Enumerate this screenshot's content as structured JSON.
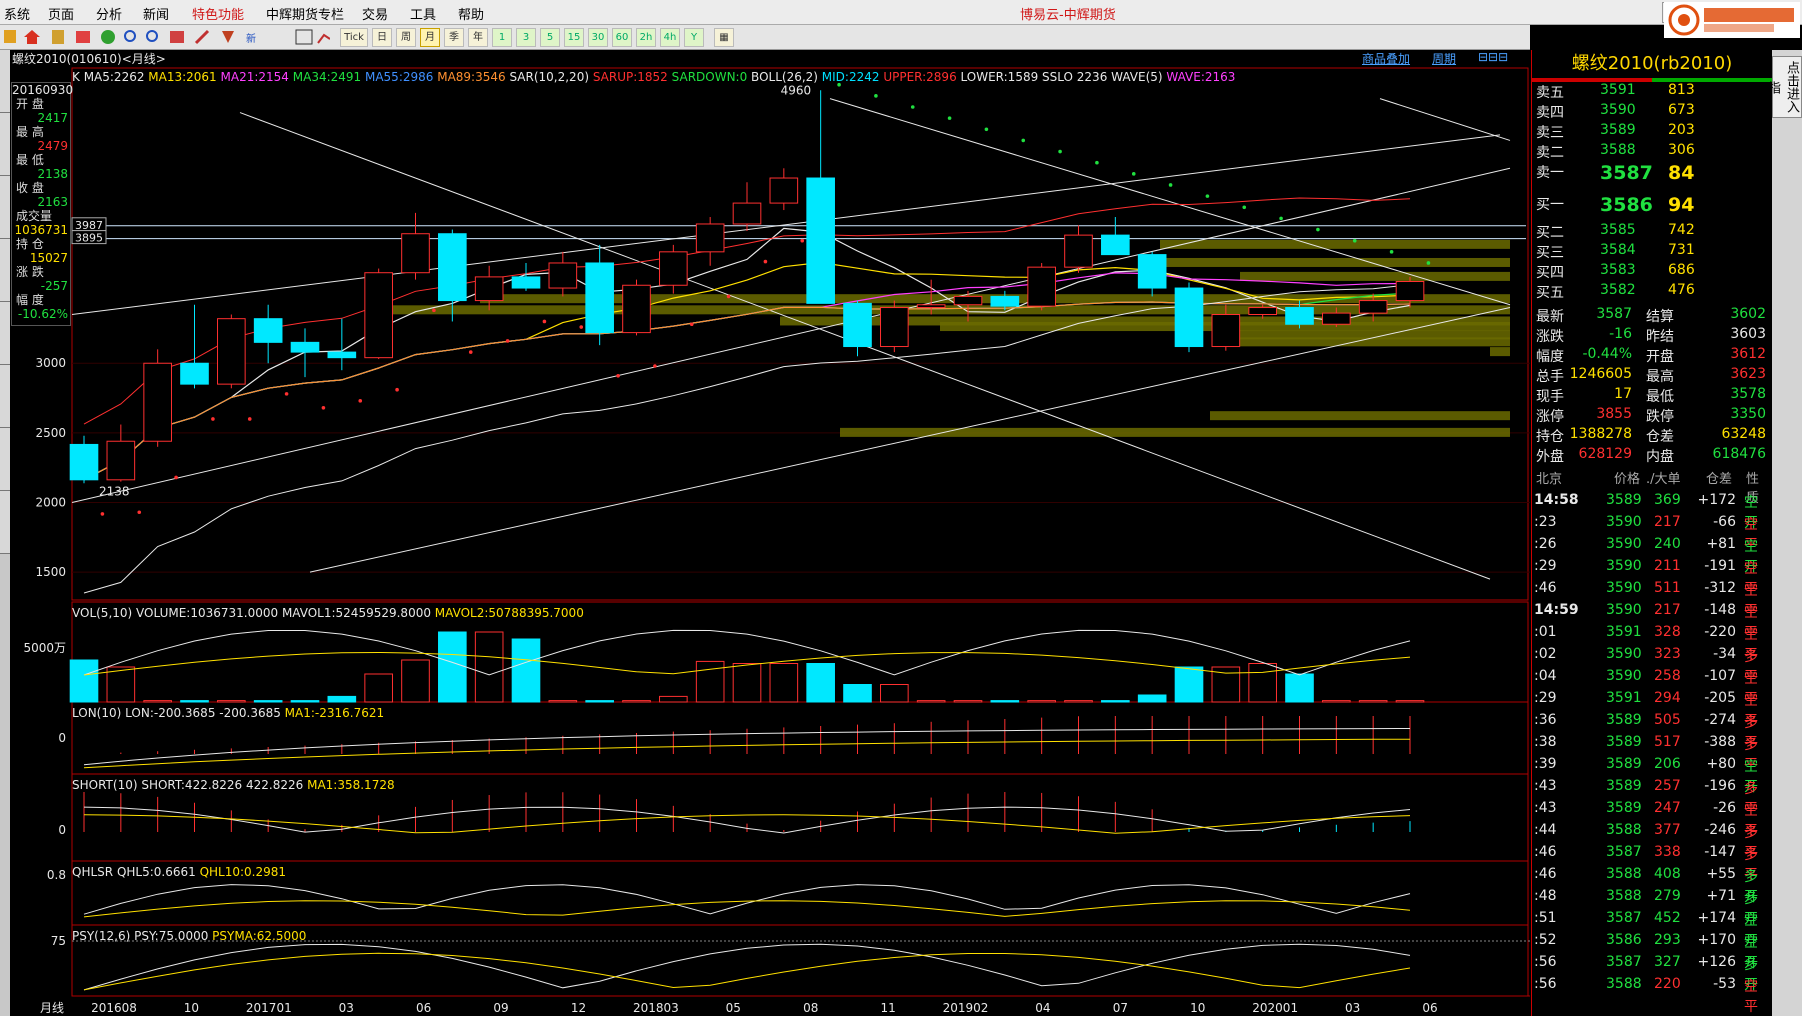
{
  "menubar": {
    "items": [
      "系统",
      "页面",
      "分析",
      "新闻",
      "特色功能",
      "中辉期货专栏",
      "交易",
      "工具",
      "帮助"
    ],
    "title": "博易云-中辉期货",
    "controls": [
      "?",
      "-",
      "□",
      "×"
    ]
  },
  "toolbar": {
    "periods": [
      "Tick",
      "日",
      "周",
      "月",
      "季",
      "年",
      "1",
      "3",
      "5",
      "15",
      "30",
      "60",
      "2h",
      "4h",
      "Y"
    ],
    "selected_period": "月"
  },
  "chart": {
    "title": "螺纹2010(010610)<月线>",
    "links": [
      "商品叠加",
      "周期"
    ],
    "ma_line": [
      {
        "t": "K",
        "c": "#e8e8e8"
      },
      {
        "t": "MA5:2262",
        "c": "#e8e8e8"
      },
      {
        "t": "MA13:2061",
        "c": "#ffe000"
      },
      {
        "t": "MA21:2154",
        "c": "#ff40ff"
      },
      {
        "t": "MA34:2491",
        "c": "#20e040"
      },
      {
        "t": "MA55:2986",
        "c": "#4090ff"
      },
      {
        "t": "MA89:3546",
        "c": "#ff9030"
      },
      {
        "t": "SAR(10,2,20)",
        "c": "#e8e8e8"
      },
      {
        "t": "SARUP:1852",
        "c": "#ff3030"
      },
      {
        "t": "SARDOWN:0",
        "c": "#20e040"
      },
      {
        "t": "BOLL(26,2)",
        "c": "#e8e8e8"
      },
      {
        "t": "MID:2242",
        "c": "#00e0ff"
      },
      {
        "t": "UPPER:2896",
        "c": "#ff3030"
      },
      {
        "t": "LOWER:1589",
        "c": "#e8e8e8"
      },
      {
        "t": "SSLO 2236",
        "c": "#e8e8e8"
      },
      {
        "t": "WAVE(5)",
        "c": "#e8e8e8"
      },
      {
        "t": "WAVE:2163",
        "c": "#ff40ff"
      }
    ],
    "y_ticks": [
      "3000",
      "2500",
      "2000",
      "1500"
    ],
    "price_labels": [
      "3987",
      "3895"
    ],
    "high_label": "4960",
    "low_label": "2138",
    "x_ticks": [
      "201608",
      "10",
      "201701",
      "03",
      "06",
      "09",
      "12",
      "201803",
      "05",
      "08",
      "11",
      "201902",
      "04",
      "07",
      "10",
      "202001",
      "03",
      "06"
    ],
    "bottom_label": "月线"
  },
  "infobox": {
    "date": "20160930",
    "fields": [
      {
        "k": "开 盘",
        "v": "2417",
        "c": "#20e040"
      },
      {
        "k": "最 高",
        "v": "2479",
        "c": "#ff3030"
      },
      {
        "k": "最 低",
        "v": "2138",
        "c": "#20e040"
      },
      {
        "k": "收 盘",
        "v": "2163",
        "c": "#20e040"
      },
      {
        "k": "成交量",
        "v": "1036731",
        "c": "#ffe000"
      },
      {
        "k": "持 仓",
        "v": "15027",
        "c": "#ffe000"
      },
      {
        "k": "涨 跌",
        "v": "-257",
        "c": "#20e040"
      },
      {
        "k": "幅 度",
        "v": "-10.62%",
        "c": "#20e040"
      }
    ]
  },
  "indicators": {
    "vol": {
      "head": [
        {
          "t": "VOL(5,10)",
          "c": "#e8e8e8"
        },
        {
          "t": "VOLUME:1036731.0000",
          "c": "#e8e8e8"
        },
        {
          "t": "MAVOL1:52459529.8000",
          "c": "#e8e8e8"
        },
        {
          "t": "MAVOL2:50788395.7000",
          "c": "#ffe000"
        }
      ],
      "tick": "5000万"
    },
    "lon": {
      "head": [
        {
          "t": "LON(10)",
          "c": "#e8e8e8"
        },
        {
          "t": "LON:-200.3685",
          "c": "#e8e8e8"
        },
        {
          "t": "-200.3685",
          "c": "#e8e8e8"
        },
        {
          "t": "MA1:-2316.7621",
          "c": "#ffe000"
        }
      ],
      "tick": "0"
    },
    "short": {
      "head": [
        {
          "t": "SHORT(10)",
          "c": "#e8e8e8"
        },
        {
          "t": "SHORT:422.8226",
          "c": "#e8e8e8"
        },
        {
          "t": "422.8226",
          "c": "#e8e8e8"
        },
        {
          "t": "MA1:358.1728",
          "c": "#ffe000"
        }
      ],
      "tick": "0"
    },
    "qhlsr": {
      "head": [
        {
          "t": "QHLSR",
          "c": "#e8e8e8"
        },
        {
          "t": "QHL5:0.6661",
          "c": "#e8e8e8"
        },
        {
          "t": "QHL10:0.2981",
          "c": "#ffe000"
        }
      ],
      "tick": "0.8"
    },
    "psy": {
      "head": [
        {
          "t": "PSY(12,6)",
          "c": "#e8e8e8"
        },
        {
          "t": "PSY:75.0000",
          "c": "#e8e8e8"
        },
        {
          "t": "PSYMA:62.5000",
          "c": "#ffe000"
        }
      ],
      "tick": "75"
    }
  },
  "quote": {
    "title": "螺纹2010(rb2010)",
    "asks": [
      {
        "label": "卖五",
        "price": "3591",
        "vol": "813"
      },
      {
        "label": "卖四",
        "price": "3590",
        "vol": "673"
      },
      {
        "label": "卖三",
        "price": "3589",
        "vol": "203"
      },
      {
        "label": "卖二",
        "price": "3588",
        "vol": "306"
      },
      {
        "label": "卖一",
        "price": "3587",
        "vol": "84"
      }
    ],
    "bids": [
      {
        "label": "买一",
        "price": "3586",
        "vol": "94"
      },
      {
        "label": "买二",
        "price": "3585",
        "vol": "742"
      },
      {
        "label": "买三",
        "price": "3584",
        "vol": "731"
      },
      {
        "label": "买四",
        "price": "3583",
        "vol": "686"
      },
      {
        "label": "买五",
        "price": "3582",
        "vol": "476"
      }
    ],
    "stats": [
      {
        "k1": "最新",
        "v1": "3587",
        "c1": "#20e040",
        "k2": "结算",
        "v2": "3602",
        "c2": "#20e040"
      },
      {
        "k1": "涨跌",
        "v1": "-16",
        "c1": "#20e040",
        "k2": "昨结",
        "v2": "3603",
        "c2": "#e8e8e8"
      },
      {
        "k1": "幅度",
        "v1": "-0.44%",
        "c1": "#20e040",
        "k2": "开盘",
        "v2": "3612",
        "c2": "#ff3030"
      },
      {
        "k1": "总手",
        "v1": "1246605",
        "c1": "#ffe000",
        "k2": "最高",
        "v2": "3623",
        "c2": "#ff3030"
      },
      {
        "k1": "现手",
        "v1": "17",
        "c1": "#ffe000",
        "k2": "最低",
        "v2": "3578",
        "c2": "#20e040"
      },
      {
        "k1": "涨停",
        "v1": "3855",
        "c1": "#ff3030",
        "k2": "跌停",
        "v2": "3350",
        "c2": "#20e040"
      },
      {
        "k1": "持仓",
        "v1": "1388278",
        "c1": "#ffe000",
        "k2": "仓差",
        "v2": "63248",
        "c2": "#ffe000"
      },
      {
        "k1": "外盘",
        "v1": "628129",
        "c1": "#ff3030",
        "k2": "内盘",
        "v2": "618476",
        "c2": "#20e040"
      }
    ],
    "tick_header": [
      "北京",
      "价格",
      "./大单",
      "仓差",
      "性质"
    ],
    "ticks": [
      {
        "time": "14:58",
        "price": "3589",
        "vol": "369",
        "diff": "+172",
        "nature": "空开"
      },
      {
        "time": ":23",
        "price": "3590",
        "vol": "217",
        "diff": "-66",
        "nature": "空平"
      },
      {
        "time": ":26",
        "price": "3590",
        "vol": "240",
        "diff": "+81",
        "nature": "空开"
      },
      {
        "time": ":29",
        "price": "3590",
        "vol": "211",
        "diff": "-191",
        "nature": "空平"
      },
      {
        "time": ":46",
        "price": "3590",
        "vol": "511",
        "diff": "-312",
        "nature": "空平"
      },
      {
        "time": "14:59",
        "price": "3590",
        "vol": "217",
        "diff": "-148",
        "nature": "空平"
      },
      {
        "time": ":01",
        "price": "3591",
        "vol": "328",
        "diff": "-220",
        "nature": "空平"
      },
      {
        "time": ":02",
        "price": "3590",
        "vol": "323",
        "diff": "-34",
        "nature": "多平"
      },
      {
        "time": ":04",
        "price": "3590",
        "vol": "258",
        "diff": "-107",
        "nature": "空平"
      },
      {
        "time": ":29",
        "price": "3591",
        "vol": "294",
        "diff": "-205",
        "nature": "空平"
      },
      {
        "time": ":36",
        "price": "3589",
        "vol": "505",
        "diff": "-274",
        "nature": "多平"
      },
      {
        "time": ":38",
        "price": "3589",
        "vol": "517",
        "diff": "-388",
        "nature": "多平"
      },
      {
        "time": ":39",
        "price": "3589",
        "vol": "206",
        "diff": "+80",
        "nature": "空开"
      },
      {
        "time": ":43",
        "price": "3589",
        "vol": "257",
        "diff": "-196",
        "nature": "多平"
      },
      {
        "time": ":43",
        "price": "3589",
        "vol": "247",
        "diff": "-26",
        "nature": "空平"
      },
      {
        "time": ":44",
        "price": "3588",
        "vol": "377",
        "diff": "-246",
        "nature": "多平"
      },
      {
        "time": ":46",
        "price": "3587",
        "vol": "338",
        "diff": "-147",
        "nature": "多平"
      },
      {
        "time": ":46",
        "price": "3588",
        "vol": "408",
        "diff": "+55",
        "nature": "多开"
      },
      {
        "time": ":48",
        "price": "3588",
        "vol": "279",
        "diff": "+71",
        "nature": "多开"
      },
      {
        "time": ":51",
        "price": "3587",
        "vol": "452",
        "diff": "+174",
        "nature": "空开"
      },
      {
        "time": ":52",
        "price": "3586",
        "vol": "293",
        "diff": "+170",
        "nature": "空开"
      },
      {
        "time": ":56",
        "price": "3587",
        "vol": "327",
        "diff": "+126",
        "nature": "多开"
      },
      {
        "time": ":56",
        "price": "3588",
        "vol": "220",
        "diff": "-53",
        "nature": "空平"
      }
    ]
  },
  "side_tab": "点击进入指",
  "candles": [
    {
      "o": 2417,
      "h": 2479,
      "l": 2138,
      "c": 2163
    },
    {
      "o": 2163,
      "h": 2560,
      "l": 2150,
      "c": 2440
    },
    {
      "o": 2440,
      "h": 3100,
      "l": 2400,
      "c": 3000
    },
    {
      "o": 3000,
      "h": 3420,
      "l": 2820,
      "c": 2850
    },
    {
      "o": 2850,
      "h": 3350,
      "l": 2820,
      "c": 3320
    },
    {
      "o": 3320,
      "h": 3420,
      "l": 3000,
      "c": 3150
    },
    {
      "o": 3150,
      "h": 3250,
      "l": 2900,
      "c": 3080
    },
    {
      "o": 3080,
      "h": 3320,
      "l": 2950,
      "c": 3040
    },
    {
      "o": 3040,
      "h": 3680,
      "l": 3030,
      "c": 3650
    },
    {
      "o": 3650,
      "h": 4080,
      "l": 3600,
      "c": 3930
    },
    {
      "o": 3930,
      "h": 3960,
      "l": 3300,
      "c": 3450
    },
    {
      "o": 3450,
      "h": 3700,
      "l": 3380,
      "c": 3620
    },
    {
      "o": 3620,
      "h": 3720,
      "l": 3520,
      "c": 3540
    },
    {
      "o": 3540,
      "h": 3800,
      "l": 3480,
      "c": 3720
    },
    {
      "o": 3720,
      "h": 3850,
      "l": 3130,
      "c": 3220
    },
    {
      "o": 3220,
      "h": 3600,
      "l": 3200,
      "c": 3560
    },
    {
      "o": 3560,
      "h": 3850,
      "l": 3500,
      "c": 3800
    },
    {
      "o": 3800,
      "h": 4050,
      "l": 3700,
      "c": 4000
    },
    {
      "o": 4000,
      "h": 4300,
      "l": 3950,
      "c": 4150
    },
    {
      "o": 4150,
      "h": 4400,
      "l": 4100,
      "c": 4330
    },
    {
      "o": 4330,
      "h": 4960,
      "l": 3800,
      "c": 3430
    },
    {
      "o": 3430,
      "h": 3450,
      "l": 3050,
      "c": 3120
    },
    {
      "o": 3120,
      "h": 3450,
      "l": 3080,
      "c": 3400
    },
    {
      "o": 3400,
      "h": 3600,
      "l": 3350,
      "c": 3420
    },
    {
      "o": 3420,
      "h": 3520,
      "l": 3300,
      "c": 3480
    },
    {
      "o": 3480,
      "h": 3520,
      "l": 3380,
      "c": 3410
    },
    {
      "o": 3410,
      "h": 3720,
      "l": 3380,
      "c": 3690
    },
    {
      "o": 3690,
      "h": 3990,
      "l": 3650,
      "c": 3920
    },
    {
      "o": 3920,
      "h": 4050,
      "l": 3820,
      "c": 3780
    },
    {
      "o": 3780,
      "h": 3800,
      "l": 3480,
      "c": 3540
    },
    {
      "o": 3540,
      "h": 3580,
      "l": 3080,
      "c": 3120
    },
    {
      "o": 3120,
      "h": 3420,
      "l": 3090,
      "c": 3350
    },
    {
      "o": 3350,
      "h": 3420,
      "l": 3320,
      "c": 3400
    },
    {
      "o": 3400,
      "h": 3450,
      "l": 3250,
      "c": 3280
    },
    {
      "o": 3280,
      "h": 3400,
      "l": 3260,
      "c": 3360
    },
    {
      "o": 3360,
      "h": 3500,
      "l": 3300,
      "c": 3450
    },
    {
      "o": 3450,
      "h": 3620,
      "l": 3400,
      "c": 3587
    }
  ]
}
